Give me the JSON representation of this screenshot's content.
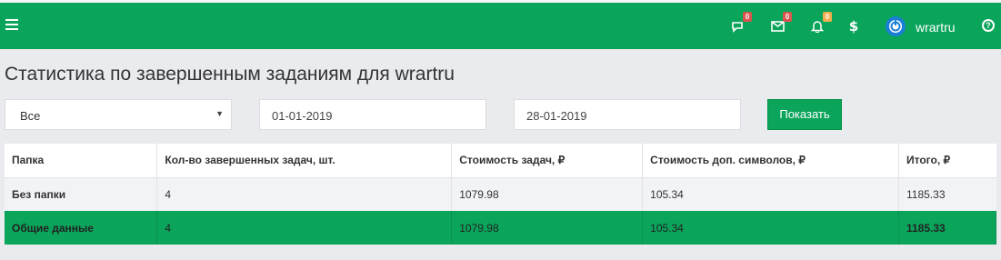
{
  "header": {
    "menu_icon": "hamburger-icon",
    "chat_badge": "0",
    "mail_badge": "0",
    "bell_badge": "0",
    "dollar": "$",
    "username": "wrartru",
    "help": "?"
  },
  "page": {
    "title": "Статистика по завершенным заданиям для wrartru"
  },
  "filters": {
    "folder_value": "Все",
    "date_from": "01-01-2019",
    "date_to": "28-01-2019",
    "show_label": "Показать"
  },
  "table": {
    "headers": [
      "Папка",
      "Кол-во завершенных задач, шт.",
      "Стоимость задач, ₽",
      "Стоимость доп. символов, ₽",
      "Итого, ₽"
    ],
    "rows": [
      [
        "Без папки",
        "4",
        "1079.98",
        "105.34",
        "1185.33"
      ]
    ],
    "total": [
      "Общие данные",
      "4",
      "1079.98",
      "105.34",
      "1185.33"
    ]
  },
  "colors": {
    "brand_green": "#0aa55b",
    "badge_red": "#d9534f",
    "badge_orange": "#f0ad4e",
    "avatar_blue": "#1b7fd6"
  }
}
